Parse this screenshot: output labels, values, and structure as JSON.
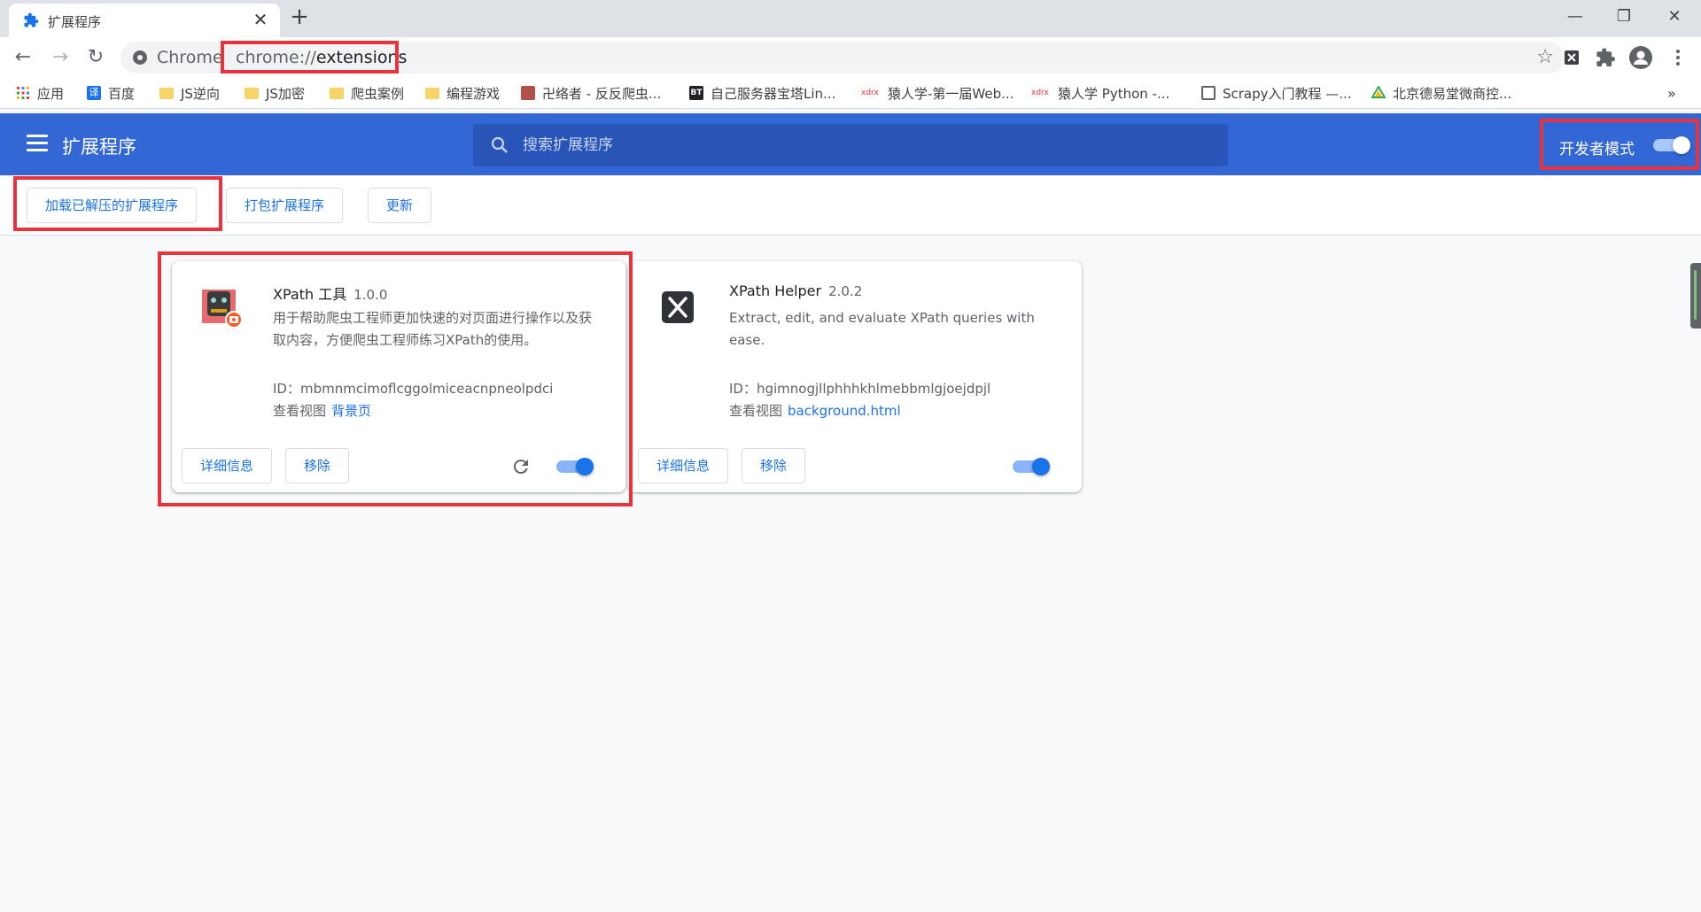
{
  "browser": {
    "tab": {
      "title": "扩展程序",
      "close": "✕"
    },
    "new_tab": "+",
    "window_controls": {
      "minimize": "—",
      "restore": "❐",
      "close": "✕"
    },
    "omnibox": {
      "scheme_label": "Chrome",
      "url_scheme": "chrome://",
      "url_host": "extensions"
    },
    "toolbar_icons": [
      "xpath-extension-icon",
      "extensions-puzzle-icon",
      "profile-avatar-icon",
      "more-menu-icon"
    ]
  },
  "bookmarks": [
    {
      "label": "应用",
      "icon": "apps-grid-icon"
    },
    {
      "label": "百度",
      "icon": "translate-icon"
    },
    {
      "label": "JS逆向",
      "icon": "folder-icon"
    },
    {
      "label": "JS加密",
      "icon": "folder-icon"
    },
    {
      "label": "爬虫案例",
      "icon": "folder-icon"
    },
    {
      "label": "编程游戏",
      "icon": "folder-icon"
    },
    {
      "label": "卍络者 - 反反爬虫...",
      "icon": "site-icon"
    },
    {
      "label": "自己服务器宝塔Lin...",
      "icon": "bt-icon"
    },
    {
      "label": "猿人学-第一届Web...",
      "icon": "yuanrenxue-icon"
    },
    {
      "label": "猿人学 Python -...",
      "icon": "yuanrenxue-icon"
    },
    {
      "label": "Scrapy入门教程 —...",
      "icon": "doc-icon"
    },
    {
      "label": "北京德易堂微商控...",
      "icon": "drive-icon"
    }
  ],
  "bookmarks_overflow": "»",
  "header": {
    "title": "扩展程序",
    "search_placeholder": "搜索扩展程序",
    "dev_mode_label": "开发者模式",
    "dev_mode_on": true
  },
  "dev_actions": {
    "load_unpacked": "加载已解压的扩展程序",
    "pack": "打包扩展程序",
    "update": "更新"
  },
  "extensions": [
    {
      "name": "XPath 工具",
      "version": "1.0.0",
      "description": "用于帮助爬虫工程师更加快速的对页面进行操作以及获取内容，方便爬虫工程师练习XPath的使用。",
      "id_label": "ID：mbmnmcimoflcggolmiceacnpneolpdci",
      "views_label": "查看视图",
      "view_link": "背景页",
      "details_button": "详细信息",
      "remove_button": "移除",
      "enabled": true,
      "has_reload": true
    },
    {
      "name": "XPath Helper",
      "version": "2.0.2",
      "description": "Extract, edit, and evaluate XPath queries with ease.",
      "id_label": "ID：hgimnogjllphhhkhlmebbmlgjoejdpjl",
      "views_label": "查看视图",
      "view_link": "background.html",
      "details_button": "详细信息",
      "remove_button": "移除",
      "enabled": true,
      "has_reload": false
    }
  ],
  "colors": {
    "header_bg": "#3367d6",
    "accent": "#1a73e8",
    "highlight": "#e8323c",
    "page_bg": "#f8f9fa"
  }
}
